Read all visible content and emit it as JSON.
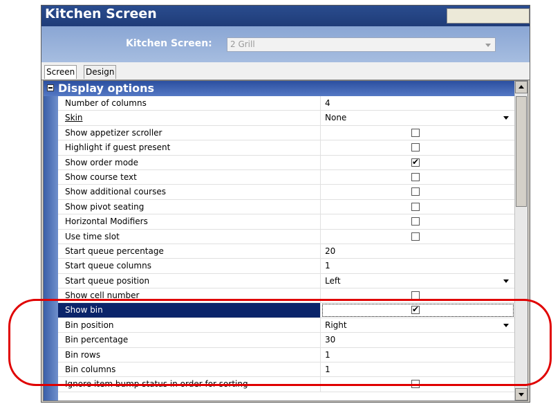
{
  "window": {
    "title": "Kitchen Screen"
  },
  "selector": {
    "label": "Kitchen Screen:",
    "value": "2 Grill"
  },
  "tabs": [
    {
      "label": "Screen"
    },
    {
      "label": "Design"
    }
  ],
  "category": {
    "title": "Display options"
  },
  "rows": [
    {
      "label": "Number of columns",
      "value": "4"
    },
    {
      "label": "Skin",
      "value": "None"
    },
    {
      "label": "Show appetizer scroller",
      "value": ""
    },
    {
      "label": "Highlight if guest present",
      "value": ""
    },
    {
      "label": "Show order mode",
      "value": "✔"
    },
    {
      "label": "Show course text",
      "value": ""
    },
    {
      "label": "Show additional courses",
      "value": ""
    },
    {
      "label": "Show pivot seating",
      "value": ""
    },
    {
      "label": "Horizontal Modifiers",
      "value": ""
    },
    {
      "label": "Use time slot",
      "value": ""
    },
    {
      "label": "Start queue percentage",
      "value": "20"
    },
    {
      "label": "Start queue columns",
      "value": "1"
    },
    {
      "label": "Start queue position",
      "value": "Left"
    },
    {
      "label": "Show cell number",
      "value": ""
    },
    {
      "label": "Show bin",
      "value": "✔"
    },
    {
      "label": "Bin position",
      "value": "Right"
    },
    {
      "label": "Bin percentage",
      "value": "30"
    },
    {
      "label": "Bin rows",
      "value": "1"
    },
    {
      "label": "Bin columns",
      "value": "1"
    },
    {
      "label": "Ignore item bump status in order for sorting",
      "value": ""
    }
  ],
  "colors": {
    "selected_row": "#0a246a",
    "highlight_outline": "#e00000",
    "title_bar": "#1f3c78"
  }
}
